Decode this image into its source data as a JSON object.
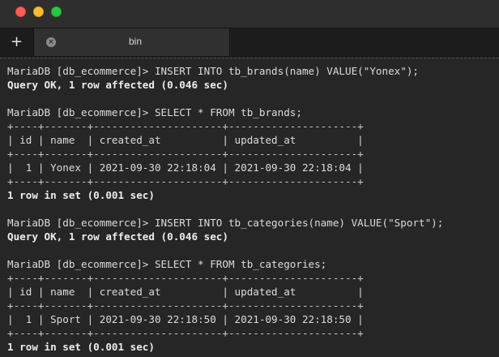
{
  "tab": {
    "new_tab_symbol": "+",
    "close_symbol": "×",
    "title": "bin"
  },
  "terminal": {
    "lines": [
      {
        "text": "MariaDB [db_ecommerce]> INSERT INTO tb_brands(name) VALUE(\"Yonex\");",
        "bold": false
      },
      {
        "text": "Query OK, 1 row affected (0.046 sec)",
        "bold": true
      },
      {
        "text": "",
        "bold": false
      },
      {
        "text": "MariaDB [db_ecommerce]> SELECT * FROM tb_brands;",
        "bold": false
      },
      {
        "text": "+----+-------+---------------------+---------------------+",
        "bold": false
      },
      {
        "text": "| id | name  | created_at          | updated_at          |",
        "bold": false
      },
      {
        "text": "+----+-------+---------------------+---------------------+",
        "bold": false
      },
      {
        "text": "|  1 | Yonex | 2021-09-30 22:18:04 | 2021-09-30 22:18:04 |",
        "bold": false
      },
      {
        "text": "+----+-------+---------------------+---------------------+",
        "bold": false
      },
      {
        "text": "1 row in set (0.001 sec)",
        "bold": true
      },
      {
        "text": "",
        "bold": false
      },
      {
        "text": "MariaDB [db_ecommerce]> INSERT INTO tb_categories(name) VALUE(\"Sport\");",
        "bold": false
      },
      {
        "text": "Query OK, 1 row affected (0.046 sec)",
        "bold": true
      },
      {
        "text": "",
        "bold": false
      },
      {
        "text": "MariaDB [db_ecommerce]> SELECT * FROM tb_categories;",
        "bold": false
      },
      {
        "text": "+----+-------+---------------------+---------------------+",
        "bold": false
      },
      {
        "text": "| id | name  | created_at          | updated_at          |",
        "bold": false
      },
      {
        "text": "+----+-------+---------------------+---------------------+",
        "bold": false
      },
      {
        "text": "|  1 | Sport | 2021-09-30 22:18:50 | 2021-09-30 22:18:50 |",
        "bold": false
      },
      {
        "text": "+----+-------+---------------------+---------------------+",
        "bold": false
      },
      {
        "text": "1 row in set (0.001 sec)",
        "bold": true
      }
    ]
  }
}
